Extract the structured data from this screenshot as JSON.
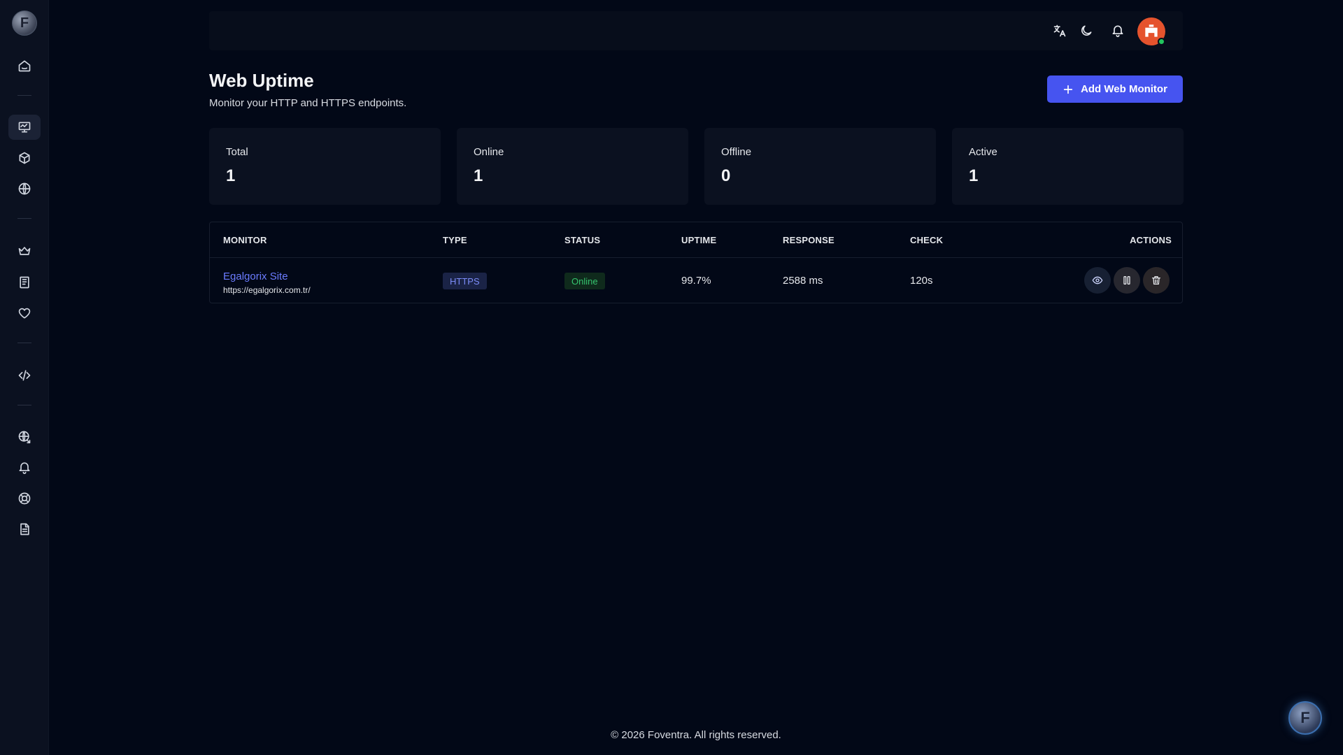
{
  "app": {
    "logo_letter": "F",
    "fab_letter": "F"
  },
  "sidebar": {
    "items": [
      {
        "name": "home",
        "icon": "home-icon"
      },
      {
        "name": "monitors",
        "icon": "monitor-icon",
        "active": true
      },
      {
        "name": "packages",
        "icon": "box-icon"
      },
      {
        "name": "web",
        "icon": "globe-icon"
      },
      {
        "name": "premium",
        "icon": "crown-icon"
      },
      {
        "name": "logs",
        "icon": "notebook-icon"
      },
      {
        "name": "favorites",
        "icon": "heart-icon"
      },
      {
        "name": "api",
        "icon": "code-icon"
      },
      {
        "name": "network",
        "icon": "globe-link-icon"
      },
      {
        "name": "notifications",
        "icon": "bell-icon"
      },
      {
        "name": "support",
        "icon": "lifebuoy-icon"
      },
      {
        "name": "documents",
        "icon": "document-icon"
      }
    ]
  },
  "header": {
    "title": "Web Uptime",
    "subtitle": "Monitor your HTTP and HTTPS endpoints.",
    "add_button": "Add Web Monitor"
  },
  "stats": [
    {
      "label": "Total",
      "value": "1"
    },
    {
      "label": "Online",
      "value": "1"
    },
    {
      "label": "Offline",
      "value": "0"
    },
    {
      "label": "Active",
      "value": "1"
    }
  ],
  "table": {
    "columns": [
      "MONITOR",
      "TYPE",
      "STATUS",
      "UPTIME",
      "RESPONSE",
      "CHECK",
      "ACTIONS"
    ],
    "rows": [
      {
        "name": "Egalgorix Site",
        "url": "https://egalgorix.com.tr/",
        "type": "HTTPS",
        "status": "Online",
        "uptime": "99.7%",
        "response": "2588 ms",
        "check": "120s"
      }
    ]
  },
  "footer": {
    "text": "© 2026 Foventra. All rights reserved."
  },
  "colors": {
    "accent": "#4654f0",
    "link": "#6b7cff",
    "online": "#35c46e",
    "background": "#020817"
  }
}
